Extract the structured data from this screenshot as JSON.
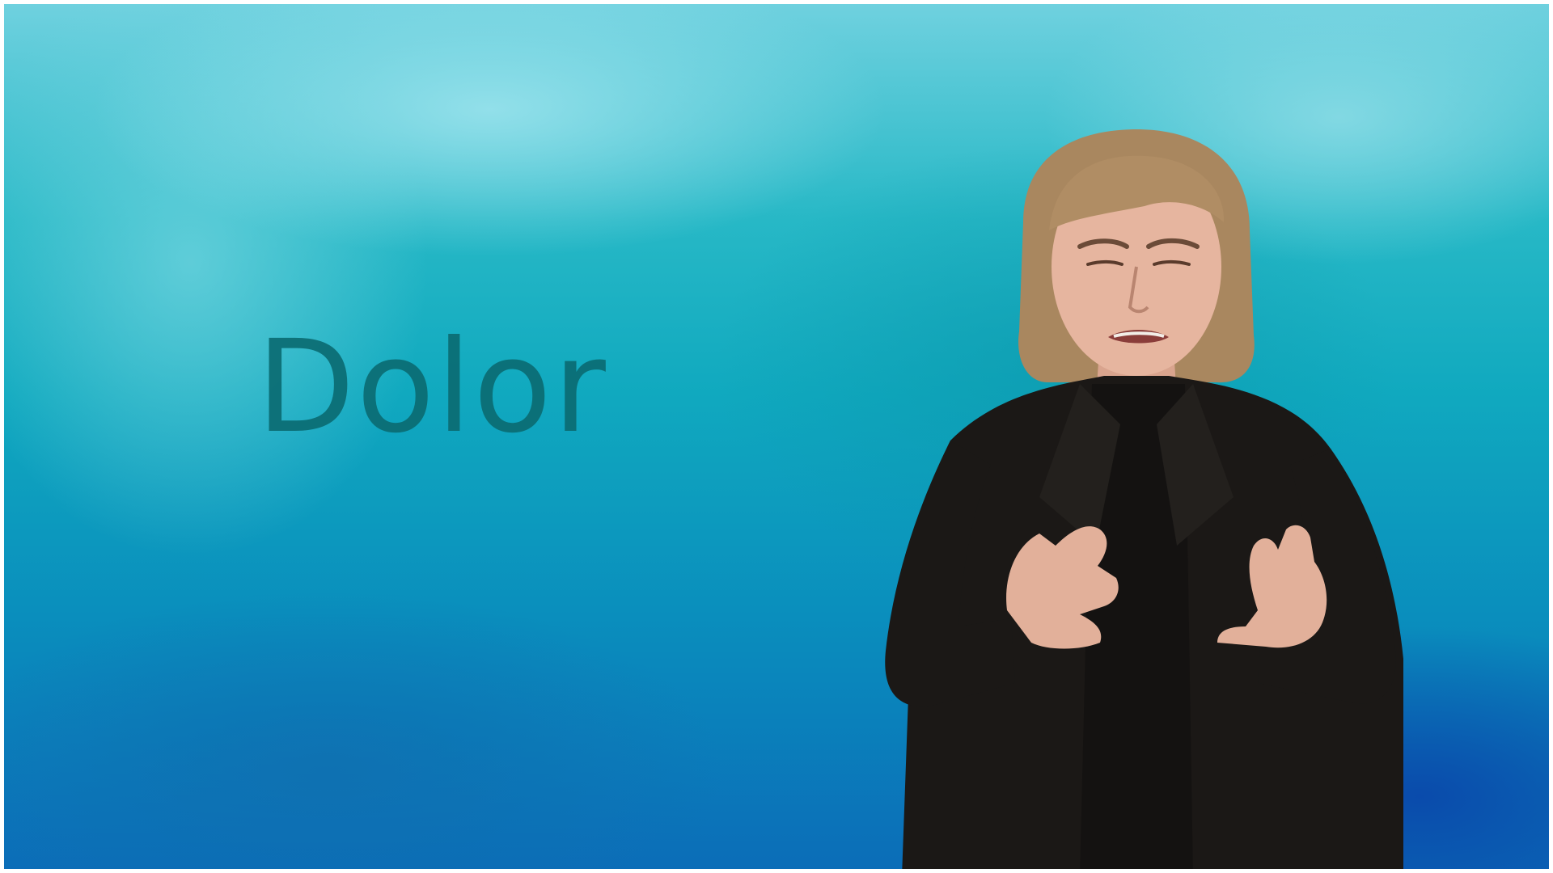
{
  "slide": {
    "title": "Dolor"
  },
  "colors": {
    "title_text": "#0b6c73",
    "background_top": "#6fd1df",
    "background_bottom": "#0b6db8",
    "jacket": "#1b1816",
    "skin": "#e2b09a",
    "hair": "#a9875f"
  }
}
